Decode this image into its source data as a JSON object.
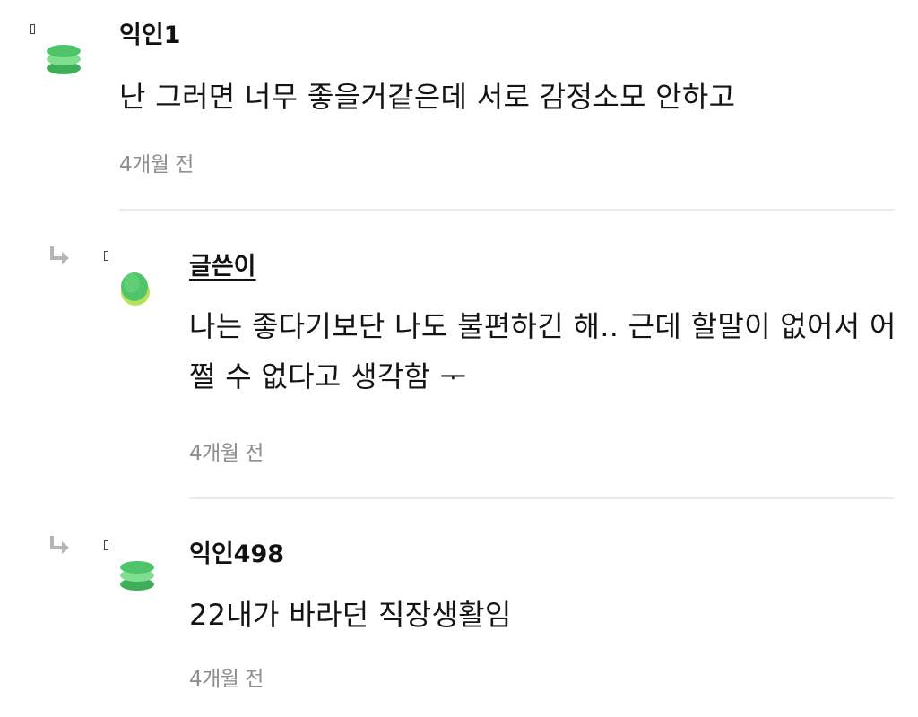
{
  "comments": [
    {
      "author": "익인1",
      "text": "난 그러면 너무 좋을거같은데 서로 감정소모 안하고",
      "time": "4개월 전",
      "is_reply": false
    },
    {
      "author": "글쓴이",
      "text": "나는 좋다기보단 나도 불편하긴 해.. 근데 할말이 없어서 어쩔 수 없다고 생각함 ᅮ",
      "time": "4개월 전",
      "is_reply": true,
      "is_op": true
    },
    {
      "author": "익인498",
      "text": "22내가 바라던 직장생활임",
      "time": "4개월 전",
      "is_reply": true
    }
  ],
  "icons": {
    "avatar": "green-stacked-disc-icon",
    "reply": "reply-arrow-icon",
    "marker": "comment-marker-icon"
  },
  "colors": {
    "avatar_green_light": "#7ee08f",
    "avatar_green_mid": "#4fc46a",
    "avatar_green_dark": "#3fae5a",
    "avatar_lime": "#b6e35b",
    "reply_arrow": "#b5b5b5",
    "time_text": "#8e8e8e",
    "divider": "#ececec"
  }
}
